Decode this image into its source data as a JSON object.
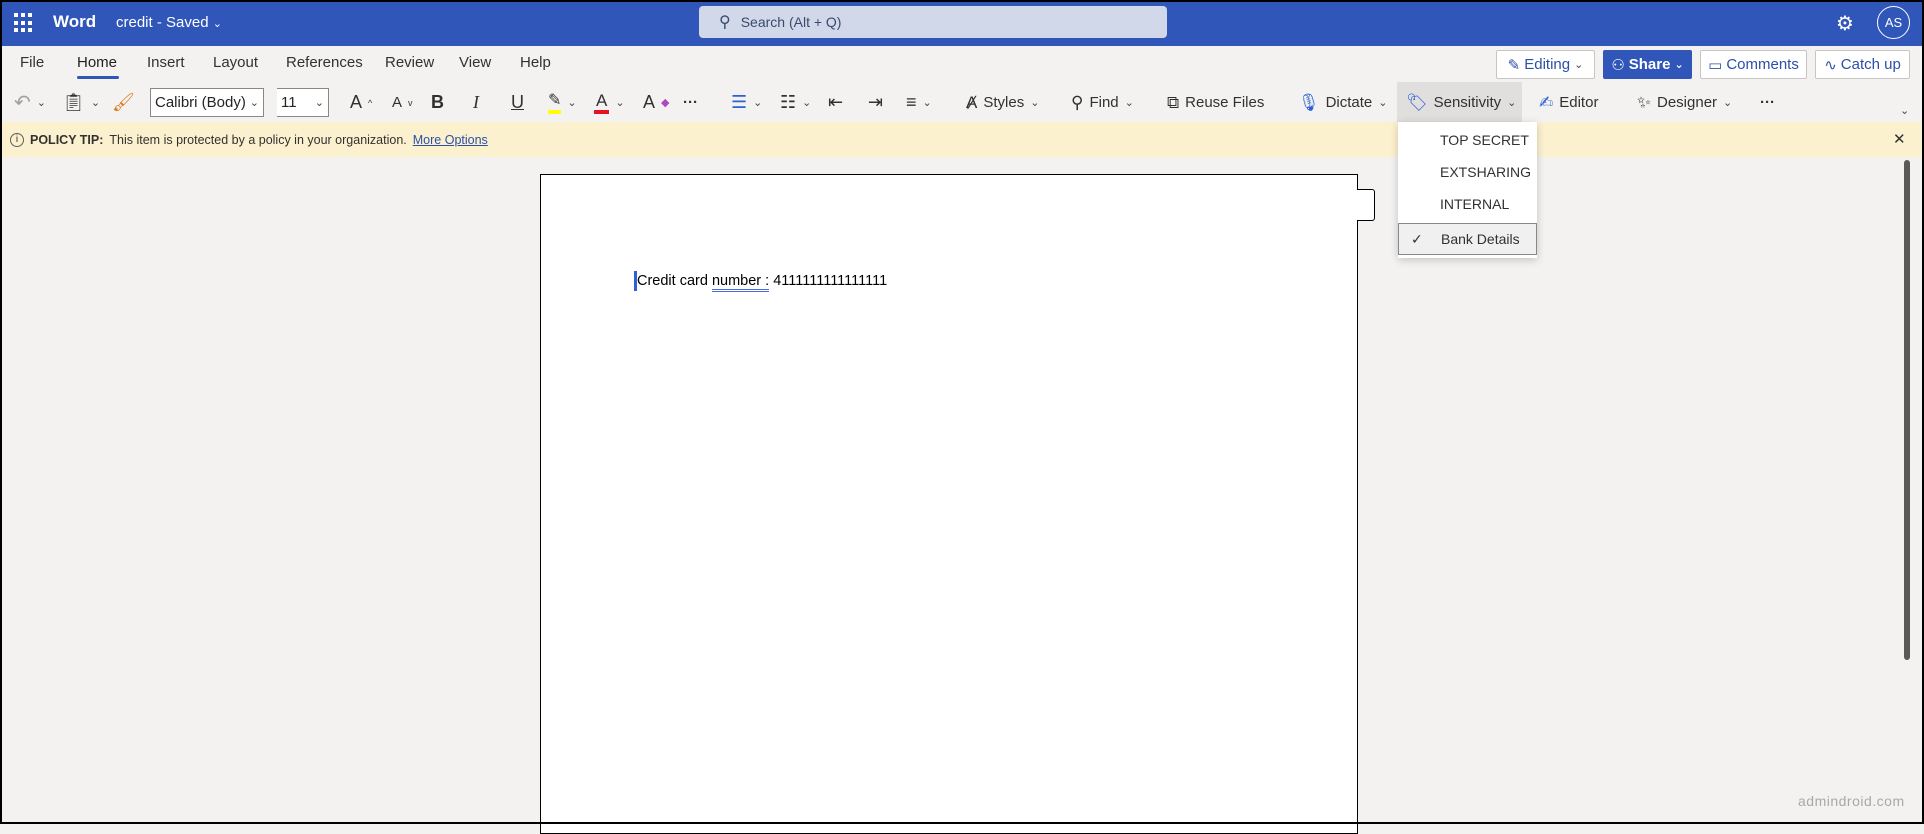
{
  "app": {
    "name": "Word",
    "doc_title": "credit",
    "separator": "-",
    "status": "Saved",
    "search_placeholder": "Search (Alt + Q)",
    "avatar": "AS"
  },
  "tabs": [
    "File",
    "Home",
    "Insert",
    "Layout",
    "References",
    "Review",
    "View",
    "Help"
  ],
  "actions": {
    "editing": "Editing",
    "share": "Share",
    "comments": "Comments",
    "catchup": "Catch up"
  },
  "toolbar": {
    "font": "Calibri (Body)",
    "size": "11",
    "bold": "B",
    "italic": "I",
    "underline": "U",
    "styles": "Styles",
    "find": "Find",
    "reuse": "Reuse Files",
    "dictate": "Dictate",
    "sensitivity": "Sensitivity",
    "editor": "Editor",
    "designer": "Designer",
    "more": "···"
  },
  "colors": {
    "highlight": "#ffff00",
    "font_color": "#e81123",
    "brand": "#3056b9"
  },
  "policy": {
    "label": "POLICY TIP:",
    "text": "This item is protected by a policy in your organization.",
    "link": "More Options"
  },
  "document": {
    "text_before": "Credit card ",
    "text_flagged": "number :",
    "text_after": " 4111111111111111"
  },
  "sensitivity_menu": {
    "items": [
      "TOP SECRET",
      "EXTSHARING",
      "INTERNAL",
      "Bank Details"
    ],
    "selected": "Bank Details",
    "check": "✓"
  },
  "watermark": "admindroid.com"
}
